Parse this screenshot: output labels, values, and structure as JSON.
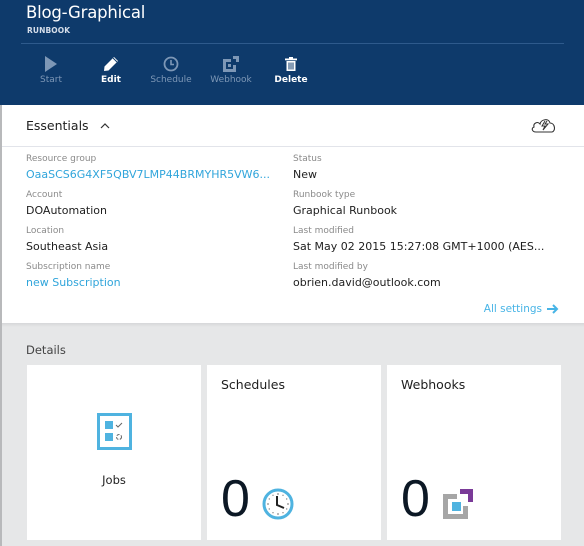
{
  "header": {
    "title": "Blog-Graphical",
    "subtitle": "RUNBOOK"
  },
  "toolbar": [
    {
      "label": "Start",
      "icon": "play-icon",
      "enabled": false
    },
    {
      "label": "Edit",
      "icon": "pencil-icon",
      "enabled": true
    },
    {
      "label": "Schedule",
      "icon": "clock-icon",
      "enabled": false
    },
    {
      "label": "Webhook",
      "icon": "webhook-icon",
      "enabled": false
    },
    {
      "label": "Delete",
      "icon": "trash-icon",
      "enabled": true
    }
  ],
  "essentials": {
    "heading": "Essentials",
    "collapse_icon": "chevron-up-icon",
    "status_icon": "cloud-lightning-icon",
    "left": [
      {
        "label": "Resource group",
        "value": "OaaSCS6G4XF5QBV7LMP44BRMYHR5VW6...",
        "link": true
      },
      {
        "label": "Account",
        "value": "DOAutomation",
        "link": false
      },
      {
        "label": "Location",
        "value": "Southeast Asia",
        "link": false
      },
      {
        "label": "Subscription name",
        "value": "new Subscription",
        "link": true
      }
    ],
    "right": [
      {
        "label": "Status",
        "value": "New"
      },
      {
        "label": "Runbook type",
        "value": "Graphical Runbook"
      },
      {
        "label": "Last modified",
        "value": "Sat May 02 2015 15:27:08 GMT+1000 (AES..."
      },
      {
        "label": "Last modified by",
        "value": "obrien.david@outlook.com"
      }
    ],
    "all_settings": "All settings",
    "all_settings_icon": "arrow-right-icon"
  },
  "details": {
    "label": "Details",
    "tiles": {
      "jobs": {
        "label": "Jobs"
      },
      "schedules": {
        "title": "Schedules",
        "count": "0"
      },
      "webhooks": {
        "title": "Webhooks",
        "count": "0"
      }
    }
  },
  "colors": {
    "header_bg": "#0e3a6b",
    "link": "#30a5db",
    "accent_blue": "#4fb3e0",
    "webhook_purple": "#7a3a98"
  }
}
